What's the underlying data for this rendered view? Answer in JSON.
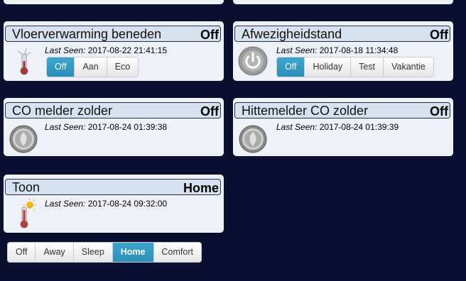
{
  "colors": {
    "background": "#0c1030",
    "card": "#eef2f8",
    "header": "#d7e2f0",
    "active_button": "#2f97c1"
  },
  "devices": [
    {
      "name": "Vloerverwarming beneden",
      "status": "Off",
      "last_seen_label": "Last Seen:",
      "last_seen": "2017-08-22 21:41:15",
      "icon": "thermometer-cold-icon",
      "buttons": [
        "Off",
        "Aan",
        "Eco"
      ],
      "active_button": "Off"
    },
    {
      "name": "Afwezigheidstand",
      "status": "Off",
      "last_seen_label": "Last Seen:",
      "last_seen": "2017-08-18 11:34:48",
      "icon": "power-icon",
      "buttons": [
        "Off",
        "Holiday",
        "Test",
        "Vakantie"
      ],
      "active_button": "Off"
    },
    {
      "name": "CO melder zolder",
      "status": "Off",
      "last_seen_label": "Last Seen:",
      "last_seen": "2017-08-24 01:39:38",
      "icon": "smoke-detector-icon"
    },
    {
      "name": "Hittemelder CO zolder",
      "status": "Off",
      "last_seen_label": "Last Seen:",
      "last_seen": "2017-08-24 01:39:39",
      "icon": "smoke-detector-icon"
    },
    {
      "name": "Toon",
      "status": "Home",
      "last_seen_label": "Last Seen:",
      "last_seen": "2017-08-24 09:32:00",
      "icon": "thermometer-hot-icon",
      "buttons": [
        "Off",
        "Away",
        "Sleep",
        "Home",
        "Comfort"
      ],
      "active_button": "Home"
    }
  ]
}
